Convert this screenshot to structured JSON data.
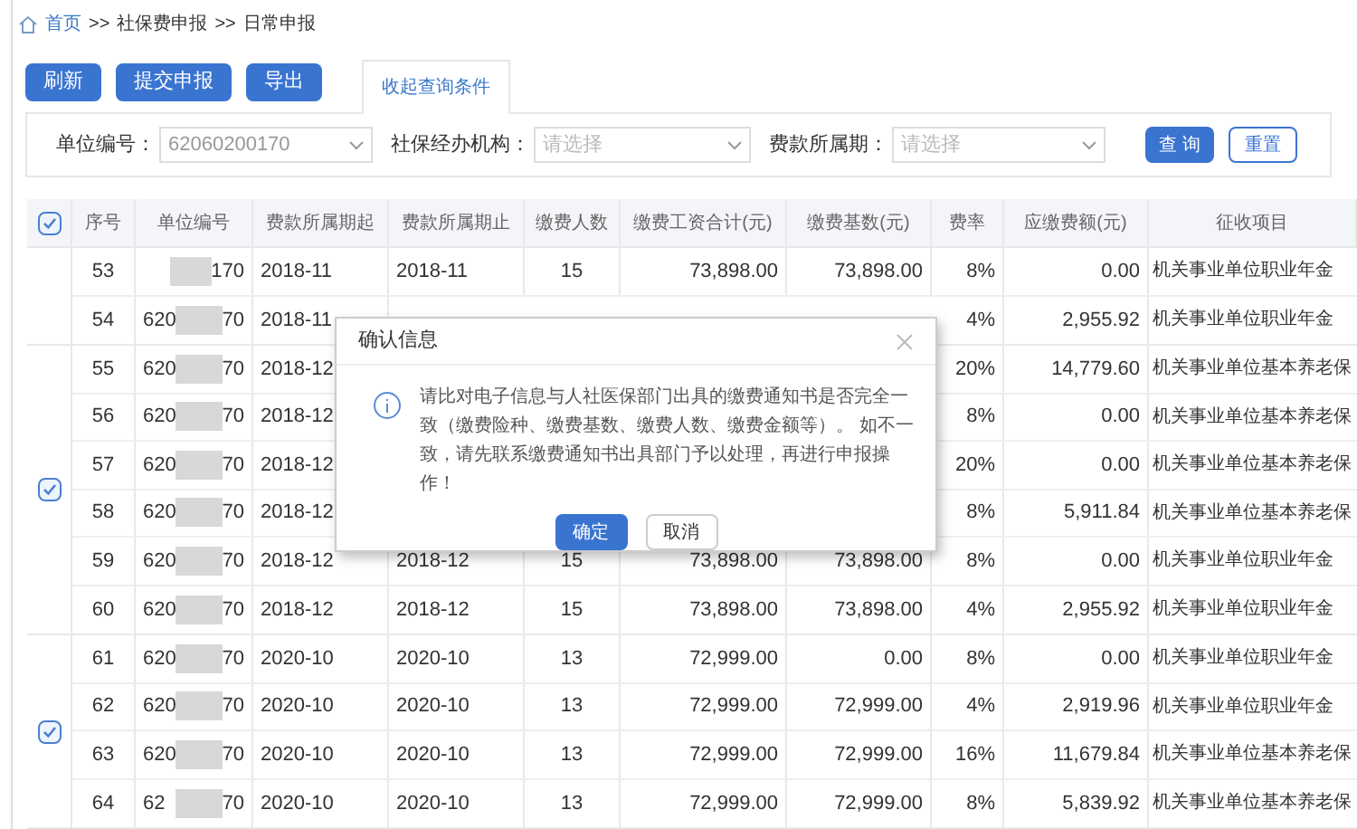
{
  "breadcrumb": [
    {
      "label": "首页",
      "link": true
    },
    {
      "label": ">>",
      "link": false
    },
    {
      "label": "社保费申报",
      "link": false
    },
    {
      "label": ">>",
      "link": false
    },
    {
      "label": "日常申报",
      "link": false
    }
  ],
  "buttons": [
    "刷新",
    "提交申报",
    "导出"
  ],
  "tab": {
    "label": "收起查询条件"
  },
  "filters": [
    {
      "label": "单位编号：",
      "value": "62060200170"
    },
    {
      "label": "社保经办机构：",
      "placeholder": "请选择"
    },
    {
      "label": "费款所属期：",
      "placeholder": "请选择"
    }
  ],
  "filter_buttons": [
    {
      "label": "查 询",
      "primary": true
    },
    {
      "label": "重置",
      "primary": false
    }
  ],
  "table": {
    "header_checked": true,
    "columns": [
      "序号",
      "单位编号",
      "费款所属期起",
      "费款所属期止",
      "缴费人数",
      "缴费工资合计(元)",
      "缴费基数(元)",
      "费率",
      "应缴费额(元)",
      "征收项目"
    ],
    "groups": [
      {
        "rows": [
          {
            "seq": "53",
            "code_start": "",
            "code_end": "170",
            "from": "2018-11",
            "to": "2018-11",
            "count": "15",
            "wage": "73,898.00",
            "base": "73,898.00",
            "rate": "8%",
            "amount": "0.00",
            "item": "机关事业单位职业年金"
          },
          {
            "seq": "54",
            "code_start": "620",
            "code_end": "70",
            "from": "2018-11",
            "rate": "4%",
            "amount": "2,955.92",
            "item": "机关事业单位职业年金"
          }
        ]
      },
      {
        "checked": true,
        "rows": [
          {
            "seq": "55",
            "code_start": "620",
            "code_end": "70",
            "from": "2018-12",
            "rate": "20%",
            "amount": "14,779.60",
            "item": "机关事业单位基本养老保"
          },
          {
            "seq": "56",
            "code_start": "620",
            "code_end": "70",
            "from": "2018-12",
            "rate": "8%",
            "amount": "0.00",
            "item": "机关事业单位基本养老保"
          },
          {
            "seq": "57",
            "code_start": "620",
            "code_end": "70",
            "from": "2018-12",
            "rate": "20%",
            "amount": "0.00",
            "item": "机关事业单位基本养老保"
          },
          {
            "seq": "58",
            "code_start": "620",
            "code_end": "70",
            "from": "2018-12",
            "rate": "8%",
            "amount": "5,911.84",
            "item": "机关事业单位基本养老保"
          },
          {
            "seq": "59",
            "code_start": "620",
            "code_end": "70",
            "from": "2018-12",
            "to": "2018-12",
            "count": "15",
            "wage": "73,898.00",
            "base": "73,898.00",
            "rate": "8%",
            "amount": "0.00",
            "item": "机关事业单位职业年金"
          },
          {
            "seq": "60",
            "code_start": "620",
            "code_end": "70",
            "from": "2018-12",
            "to": "2018-12",
            "count": "15",
            "wage": "73,898.00",
            "base": "73,898.00",
            "rate": "4%",
            "amount": "2,955.92",
            "item": "机关事业单位职业年金"
          }
        ]
      },
      {
        "checked": true,
        "rows": [
          {
            "seq": "61",
            "code_start": "620",
            "code_end": "70",
            "from": "2020-10",
            "to": "2020-10",
            "count": "13",
            "wage": "72,999.00",
            "base": "0.00",
            "rate": "8%",
            "amount": "0.00",
            "item": "机关事业单位职业年金"
          },
          {
            "seq": "62",
            "code_start": "620",
            "code_end": "70",
            "from": "2020-10",
            "to": "2020-10",
            "count": "13",
            "wage": "72,999.00",
            "base": "72,999.00",
            "rate": "4%",
            "amount": "2,919.96",
            "item": "机关事业单位职业年金"
          },
          {
            "seq": "63",
            "code_start": "620",
            "code_end": "70",
            "from": "2020-10",
            "to": "2020-10",
            "count": "13",
            "wage": "72,999.00",
            "base": "72,999.00",
            "rate": "16%",
            "amount": "11,679.84",
            "item": "机关事业单位基本养老保"
          },
          {
            "seq": "64",
            "code_start": "62",
            "code_end": "70",
            "from": "2020-10",
            "to": "2020-10",
            "count": "13",
            "wage": "72,999.00",
            "base": "72,999.00",
            "rate": "8%",
            "amount": "5,839.92",
            "item": "机关事业单位基本养老保"
          }
        ]
      }
    ]
  },
  "dialog": {
    "title": "确认信息",
    "message": "请比对电子信息与人社医保部门出具的缴费通知书是否完全一致（缴费险种、缴费基数、缴费人数、缴费金额等）。 如不一致，请先联系缴费通知书出具部门予以处理，再进行申报操作！",
    "buttons": [
      {
        "label": "确定",
        "primary": true
      },
      {
        "label": "取消",
        "primary": false
      }
    ]
  }
}
